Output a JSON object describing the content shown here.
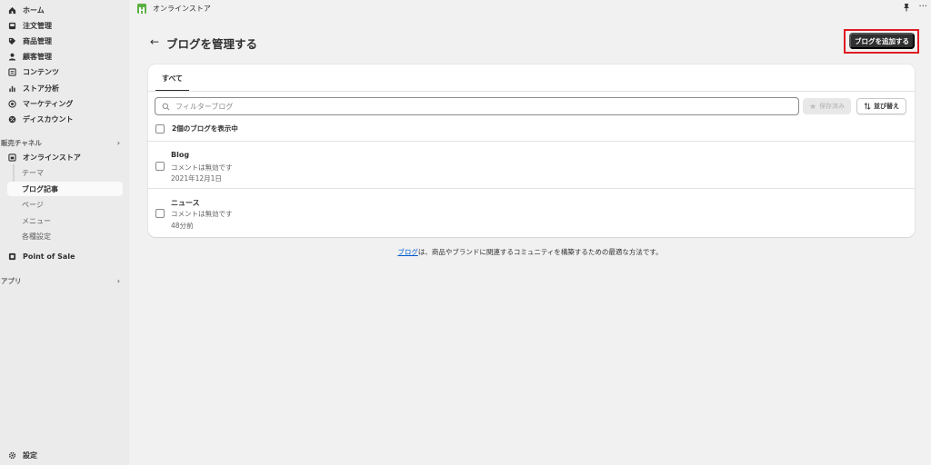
{
  "sidebar": {
    "main_items": [
      {
        "label": "ホーム",
        "icon": "home-icon"
      },
      {
        "label": "注文管理",
        "icon": "inbox-icon"
      },
      {
        "label": "商品管理",
        "icon": "tag-icon"
      },
      {
        "label": "顧客管理",
        "icon": "person-icon"
      },
      {
        "label": "コンテンツ",
        "icon": "content-icon"
      },
      {
        "label": "ストア分析",
        "icon": "bar-chart-icon"
      },
      {
        "label": "マーケティング",
        "icon": "target-icon"
      },
      {
        "label": "ディスカウント",
        "icon": "discount-icon"
      }
    ],
    "sales_channels_heading": "販売チャネル",
    "online_store_label": "オンラインストア",
    "online_store_subitems": [
      {
        "label": "テーマ"
      },
      {
        "label": "ブログ記事"
      },
      {
        "label": "ページ"
      },
      {
        "label": "メニュー"
      },
      {
        "label": "各種設定"
      }
    ],
    "pos_label": "Point of Sale",
    "apps_heading": "アプリ",
    "settings_label": "設定"
  },
  "topbar": {
    "store_name": "オンラインストア",
    "more_label": "···"
  },
  "page": {
    "back_label": "←",
    "title": "ブログを管理する",
    "add_button_label": "ブログを追加する"
  },
  "card": {
    "tab_all": "すべて",
    "search_placeholder": "フィルターブログ",
    "saved_label": "保存済み",
    "sort_label": "並び替え",
    "count_label": "2個のブログを表示中",
    "rows": [
      {
        "title": "Blog",
        "comments": "コメントは無効です",
        "date": "2021年12月1日"
      },
      {
        "title": "ニュース",
        "comments": "コメントは無効です",
        "date": "48分前"
      }
    ]
  },
  "footer": {
    "link_text": "ブログ",
    "rest_text": "は、商品やブランドに関連するコミュニティを構築するための最適な方法です。"
  },
  "colors": {
    "primary_button": "#303030",
    "highlight": "#e01b24",
    "link": "#005bd3",
    "logo_green": "#5bb043"
  }
}
